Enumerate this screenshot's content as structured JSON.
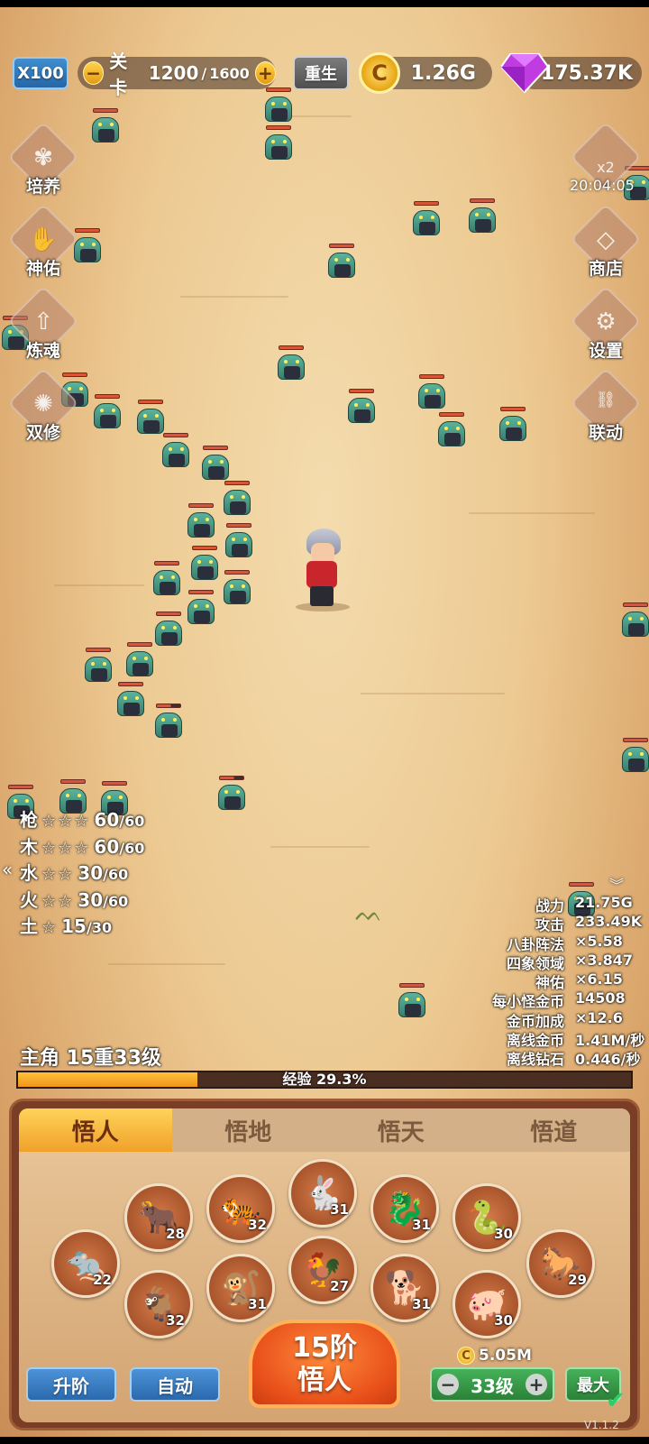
{
  "topbar": {
    "speed_label": "X100",
    "minus": "−",
    "stage_label": "关卡",
    "stage_current": "1200",
    "stage_separator": "/",
    "stage_max": "1600",
    "plus": "+",
    "reborn_label": "重生",
    "coin_glyph": "C",
    "gold_value": "1.26G",
    "gem_value": "175.37K"
  },
  "left_menu": [
    {
      "label": "培养",
      "icon": "cultivate-icon"
    },
    {
      "label": "神佑",
      "icon": "blessing-icon"
    },
    {
      "label": "炼魂",
      "icon": "soul-refine-icon"
    },
    {
      "label": "双修",
      "icon": "dual-cultivation-icon"
    }
  ],
  "right_menu": {
    "bonus_label": "x2",
    "timer": "20:04:05",
    "shop": "商店",
    "settings": "设置",
    "link": "联动"
  },
  "elements": [
    {
      "name": "枪",
      "stars": "☆☆☆",
      "value": "60",
      "max": "/60"
    },
    {
      "name": "木",
      "stars": "☆☆☆",
      "value": "60",
      "max": "/60"
    },
    {
      "name": "水",
      "stars": "☆☆",
      "value": "30",
      "max": "/60"
    },
    {
      "name": "火",
      "stars": "☆☆",
      "value": "30",
      "max": "/60"
    },
    {
      "name": "土",
      "stars": "☆",
      "value": "15",
      "max": "/30"
    }
  ],
  "collapse_left": "«",
  "stats_toggle": "︾",
  "stats": [
    {
      "key": "战力",
      "value": "21.75G"
    },
    {
      "key": "攻击",
      "value": "233.49K"
    },
    {
      "key": "八卦阵法",
      "value": "×5.58"
    },
    {
      "key": "四象领域",
      "value": "×3.847"
    },
    {
      "key": "神佑",
      "value": "×6.15"
    },
    {
      "key": "每小怪金币",
      "value": "14508"
    },
    {
      "key": "金币加成",
      "value": "×12.6"
    },
    {
      "key": "离线金币",
      "value": "1.41M/秒"
    },
    {
      "key": "离线钻石",
      "value": "0.446/秒"
    }
  ],
  "main_character": "主角 15重33级",
  "experience": {
    "label": "经验 29.3%",
    "fraction": 0.293
  },
  "tabs": [
    "悟人",
    "悟地",
    "悟天",
    "悟道"
  ],
  "zodiac": [
    {
      "name": "rat",
      "glyph": "🐀",
      "level": "22"
    },
    {
      "name": "ox",
      "glyph": "🐂",
      "level": "28"
    },
    {
      "name": "goat",
      "glyph": "🐐",
      "level": "32"
    },
    {
      "name": "tiger",
      "glyph": "🐅",
      "level": "32"
    },
    {
      "name": "monkey",
      "glyph": "🐒",
      "level": "31"
    },
    {
      "name": "rabbit",
      "glyph": "🐇",
      "level": "31"
    },
    {
      "name": "rooster",
      "glyph": "🐓",
      "level": "27"
    },
    {
      "name": "dragon",
      "glyph": "🐉",
      "level": "31"
    },
    {
      "name": "dog",
      "glyph": "🐕",
      "level": "31"
    },
    {
      "name": "snake",
      "glyph": "🐍",
      "level": "30"
    },
    {
      "name": "pig",
      "glyph": "🐖",
      "level": "30"
    },
    {
      "name": "horse",
      "glyph": "🐎",
      "level": "29"
    }
  ],
  "bottom": {
    "upgrade_label": "升阶",
    "auto_label": "自动",
    "main_line1": "15阶",
    "main_line2": "悟人",
    "cost": "5.05M",
    "level_minus": "−",
    "level_value": "33级",
    "level_plus": "+",
    "max_label": "最大",
    "version": "V1.1.2"
  },
  "colors": {
    "sand": "#ecc991",
    "accent_orange": "#f0a12a",
    "button_blue": "#2a69ad",
    "button_green": "#2b8138"
  }
}
